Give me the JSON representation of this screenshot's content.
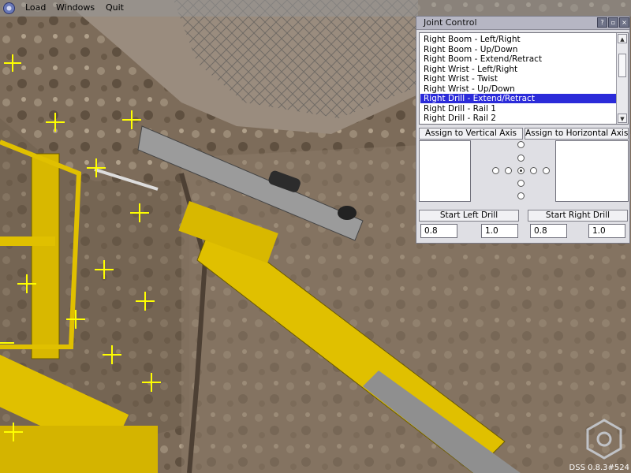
{
  "menubar": {
    "items": [
      "Load",
      "Windows",
      "Quit"
    ],
    "logo_icon": "app-logo-icon"
  },
  "joint_control": {
    "title": "Joint Control",
    "list": [
      "Right Boom - Left/Right",
      "Right Boom - Up/Down",
      "Right Boom - Extend/Retract",
      "Right Wrist - Left/Right",
      "Right Wrist - Twist",
      "Right Wrist - Up/Down",
      "Right Drill - Extend/Retract",
      "Right Drill - Rail 1",
      "Right Drill - Rail 2"
    ],
    "selected_index": 6,
    "assign_vertical": "Assign to Vertical Axis",
    "assign_horizontal": "Assign to Horizontal Axis",
    "start_left": "Start Left Drill",
    "start_right": "Start Right Drill",
    "field_values": [
      "0.8",
      "1.0",
      "0.8",
      "1.0"
    ]
  },
  "version": "DSS 0.8.3#524",
  "colors": {
    "selection": "#2b2bd9",
    "machine_yellow": "#e0c000",
    "marker": "#ffff00"
  }
}
